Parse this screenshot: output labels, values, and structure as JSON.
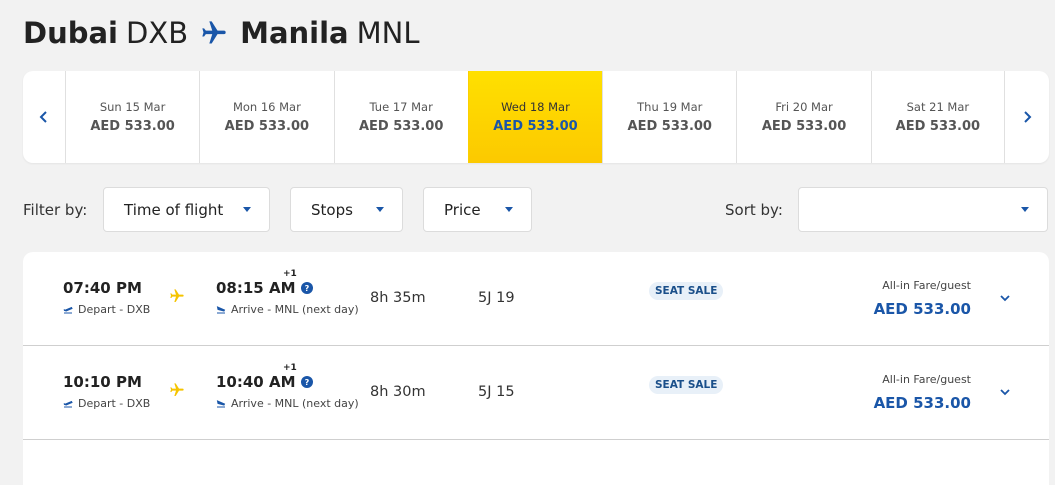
{
  "header": {
    "origin_city": "Dubai",
    "origin_code": "DXB",
    "dest_city": "Manila",
    "dest_code": "MNL",
    "plane_icon": "airplane-icon"
  },
  "date_strip": {
    "prev_icon": "chevron-left-icon",
    "next_icon": "chevron-right-icon",
    "dates": [
      {
        "label": "Sun 15 Mar",
        "price": "AED 533.00"
      },
      {
        "label": "Mon 16 Mar",
        "price": "AED 533.00"
      },
      {
        "label": "Tue 17 Mar",
        "price": "AED 533.00"
      },
      {
        "label": "Wed 18 Mar",
        "price": "AED 533.00",
        "selected": true
      },
      {
        "label": "Thu 19 Mar",
        "price": "AED 533.00"
      },
      {
        "label": "Fri 20 Mar",
        "price": "AED 533.00"
      },
      {
        "label": "Sat 21 Mar",
        "price": "AED 533.00"
      }
    ]
  },
  "filters": {
    "filter_label": "Filter by:",
    "time_of_flight": "Time of flight",
    "stops": "Stops",
    "price": "Price",
    "sort_label": "Sort by:",
    "sort_value": ""
  },
  "flights": [
    {
      "depart_time": "07:40 PM",
      "depart_sub": "Depart - DXB",
      "arrive_time": "08:15 AM",
      "plus_day": "+1",
      "arrive_sub": "Arrive - MNL (next day)",
      "duration": "8h 35m",
      "flight_no": "5J 19",
      "badge": "SEAT SALE",
      "fare_label": "All-in Fare/guest",
      "fare": "AED 533.00"
    },
    {
      "depart_time": "10:10 PM",
      "depart_sub": "Depart - DXB",
      "arrive_time": "10:40 AM",
      "plus_day": "+1",
      "arrive_sub": "Arrive - MNL (next day)",
      "duration": "8h 30m",
      "flight_no": "5J 15",
      "badge": "SEAT SALE",
      "fare_label": "All-in Fare/guest",
      "fare": "AED 533.00"
    }
  ],
  "colors": {
    "accent_blue": "#1a56a8",
    "selected_yellow": "#fcd000",
    "plane_yellow": "#f5c400"
  }
}
